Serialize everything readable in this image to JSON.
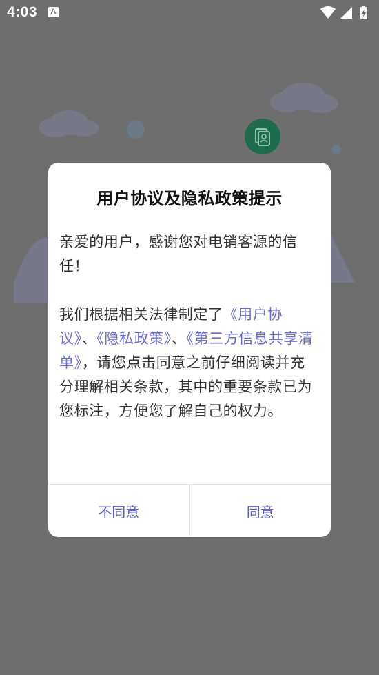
{
  "status_bar": {
    "time": "4:03",
    "notification_icon": "A"
  },
  "dialog": {
    "title": "用户协议及隐私政策提示",
    "greeting": "亲爱的用户，感谢您对电销客源的信任！",
    "intro": "我们根据相关法律制定了",
    "link_user_agreement": "《用户协议》",
    "sep1": "、",
    "link_privacy_policy": "《隐私政策》",
    "sep2": "、",
    "link_third_party_list": "《第三方信息共享清单》",
    "tail": "，请您点击同意之前仔细阅读并充分理解相关条款，其中的重要条款已为您标注，方便您了解自己的权力。",
    "disagree_label": "不同意",
    "agree_label": "同意"
  },
  "colors": {
    "link": "#6b6bd6",
    "button_text": "#5c5ccc",
    "app_icon": "#1e7a5a"
  }
}
